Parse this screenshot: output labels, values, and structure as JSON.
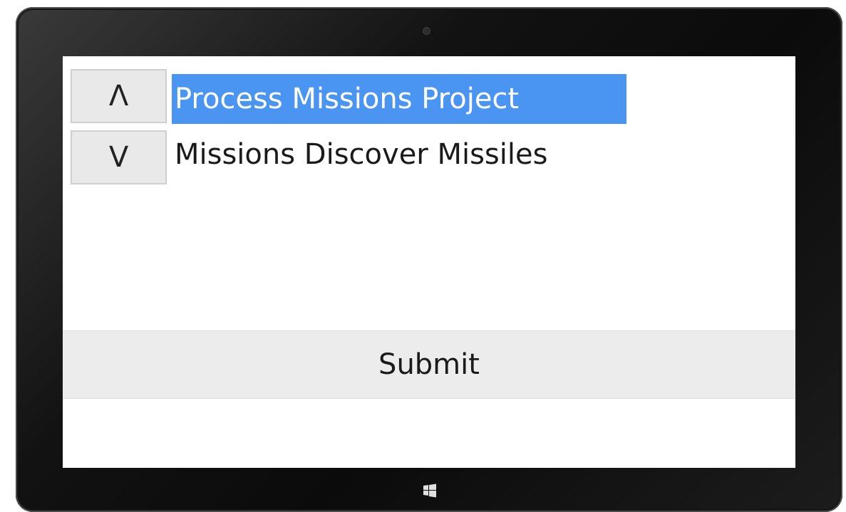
{
  "move_controls": {
    "up_glyph": "Λ",
    "down_glyph": "V"
  },
  "list": {
    "items": [
      {
        "label": "Process Missions Project",
        "selected": true
      },
      {
        "label": "Missions Discover Missiles",
        "selected": false
      }
    ]
  },
  "actions": {
    "submit_label": "Submit"
  },
  "colors": {
    "selection": "#4a95f2",
    "button_bg": "#e9e9e9",
    "bezel": "#121212"
  },
  "icons": {
    "camera": "camera-icon",
    "windows": "windows-logo-icon"
  }
}
